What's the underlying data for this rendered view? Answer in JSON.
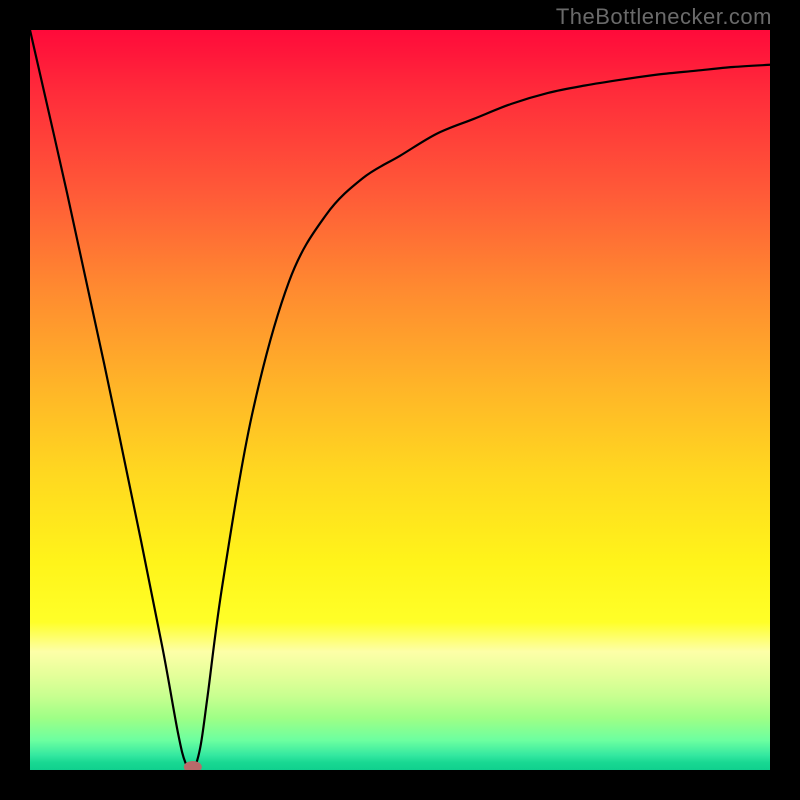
{
  "attribution": "TheBottlenecker.com",
  "chart_data": {
    "type": "line",
    "title": "",
    "xlabel": "",
    "ylabel": "",
    "xlim": [
      0,
      100
    ],
    "ylim": [
      0,
      100
    ],
    "x": [
      0,
      5,
      10,
      15,
      18,
      20,
      21,
      22,
      23,
      24,
      26,
      30,
      35,
      40,
      45,
      50,
      55,
      60,
      65,
      70,
      75,
      80,
      85,
      90,
      95,
      100
    ],
    "values": [
      100,
      78,
      55,
      31,
      16,
      5,
      1,
      0,
      3,
      10,
      25,
      48,
      66,
      75,
      80,
      83,
      86,
      88,
      90,
      91.5,
      92.5,
      93.3,
      94,
      94.5,
      95,
      95.3
    ],
    "marker": {
      "x": 22,
      "y": 0
    },
    "gradient_top_color": "#ff0a3a",
    "gradient_bottom_color": "#10d08e",
    "curve_color": "#000000"
  }
}
